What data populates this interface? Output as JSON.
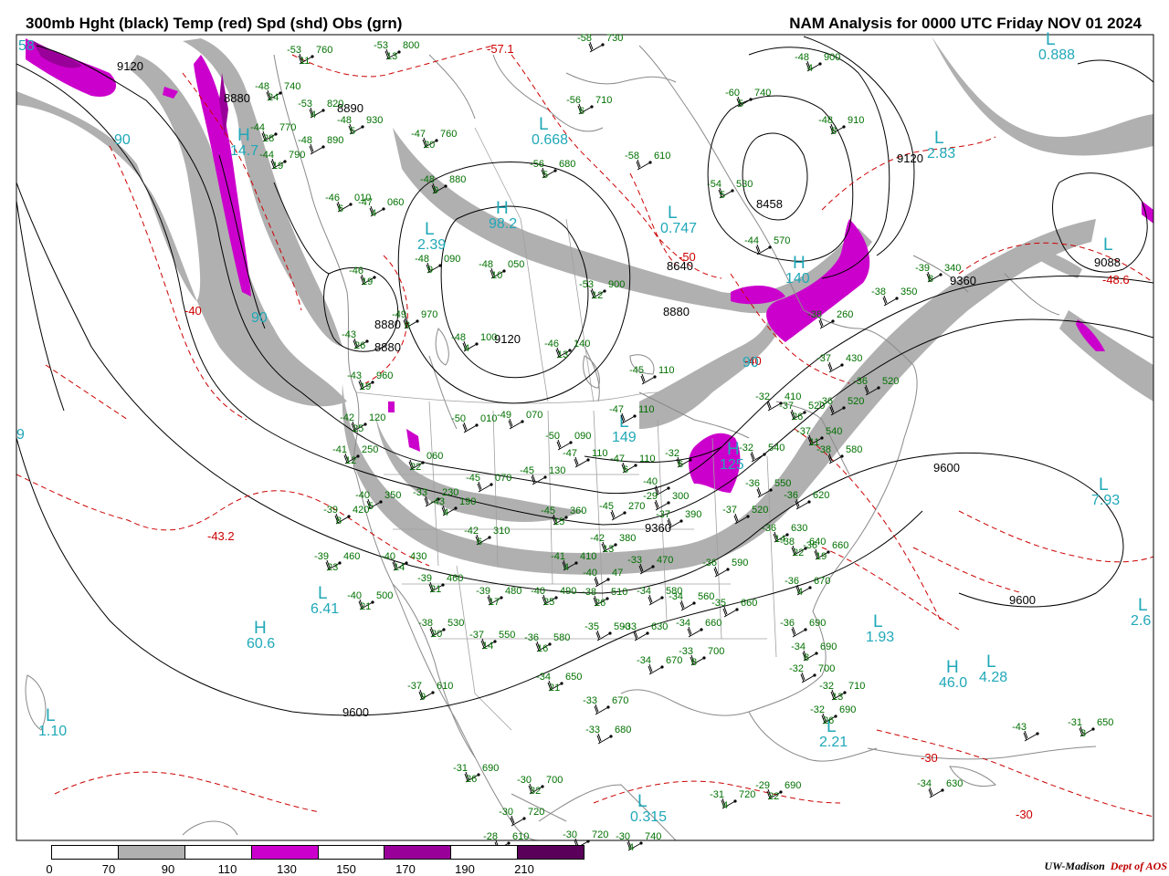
{
  "header": {
    "title_left": "300mb Hght (black) Temp (red) Spd (shd) Obs (grn)",
    "title_right": "NAM Analysis for 0000 UTC Friday  NOV 01 2024"
  },
  "colors": {
    "height_contour": "#000000",
    "temp_contour": "#cc0000",
    "obs": "#007000",
    "pressure_center": "#20a8b8",
    "coast": "#8a8a8a",
    "speed_70_90": "#b0b0b0",
    "speed_110_130": "#cc00cc",
    "speed_150_170": "#990099",
    "speed_190_210": "#5a005a"
  },
  "legend": {
    "ticks": [
      "0",
      "70",
      "90",
      "110",
      "130",
      "150",
      "170",
      "190",
      "210"
    ],
    "colors": [
      "#ffffff",
      "#b0b0b0",
      "#ffffff",
      "#cc00cc",
      "#ffffff",
      "#990099",
      "#ffffff",
      "#5a005a"
    ]
  },
  "credit": {
    "org": "UW-Madison",
    "dept": "Dept of AOS"
  },
  "height_labels": [
    "9120",
    "8880",
    "8890",
    "9120",
    "8458",
    "8640",
    "8880",
    "9360",
    "9120",
    "9088",
    "9360",
    "9600",
    "9600",
    "9600",
    "8880",
    "8880"
  ],
  "temp_labels": [
    "-57.1",
    "-50",
    "-40",
    "-40",
    "-43.2",
    "-48.6",
    "-30",
    "-30"
  ],
  "centers": [
    {
      "type": "H",
      "value": "14.7"
    },
    {
      "type": "L",
      "value": "0.668"
    },
    {
      "type": "H",
      "value": "98.2"
    },
    {
      "type": "L",
      "value": "0.747"
    },
    {
      "type": "L",
      "value": "2.39"
    },
    {
      "type": "L",
      "value": "2.83"
    },
    {
      "type": "L",
      "value": "0.888"
    },
    {
      "type": "H",
      "value": "140"
    },
    {
      "type": "L",
      "value": "149"
    },
    {
      "type": "H",
      "value": "125"
    },
    {
      "type": "L",
      "value": "7.93"
    },
    {
      "type": "H",
      "value": "60.6"
    },
    {
      "type": "L",
      "value": "6.41"
    },
    {
      "type": "L",
      "value": "1.93"
    },
    {
      "type": "H",
      "value": "46.0"
    },
    {
      "type": "L",
      "value": "4.28"
    },
    {
      "type": "L",
      "value": "2.21"
    },
    {
      "type": "L",
      "value": "1.10"
    },
    {
      "type": "L",
      "value": "0.315"
    },
    {
      "type": "L",
      "value": "2.6"
    },
    {
      "type": "L",
      "value": ""
    }
  ],
  "speed_labels": [
    "90",
    "90",
    "90",
    "58",
    "9"
  ],
  "stations": [
    {
      "temp": "-53",
      "hgt": "760",
      "sub": "11"
    },
    {
      "temp": "-53",
      "hgt": "800",
      "sub": "13"
    },
    {
      "temp": "-58",
      "hgt": "730",
      "sub": ""
    },
    {
      "temp": "-48",
      "hgt": "740",
      "sub": "24"
    },
    {
      "temp": "-53",
      "hgt": "820",
      "sub": "4"
    },
    {
      "temp": "-48",
      "hgt": "930",
      "sub": "5"
    },
    {
      "temp": "-44",
      "hgt": "770",
      "sub": "28"
    },
    {
      "temp": "-44",
      "hgt": "790",
      "sub": "19"
    },
    {
      "temp": "-48",
      "hgt": "890",
      "sub": ""
    },
    {
      "temp": "-47",
      "hgt": "760",
      "sub": "20"
    },
    {
      "temp": "-56",
      "hgt": "710",
      "sub": "6"
    },
    {
      "temp": "-56",
      "hgt": "680",
      "sub": "5"
    },
    {
      "temp": "-58",
      "hgt": "610",
      "sub": ""
    },
    {
      "temp": "-60",
      "hgt": "740",
      "sub": "5"
    },
    {
      "temp": "-48",
      "hgt": "900",
      "sub": "4"
    },
    {
      "temp": "-48",
      "hgt": "910",
      "sub": "8"
    },
    {
      "temp": "-54",
      "hgt": "530",
      "sub": "5"
    },
    {
      "temp": "-44",
      "hgt": "570",
      "sub": ""
    },
    {
      "temp": "-48",
      "hgt": "880",
      "sub": "9"
    },
    {
      "temp": "-46",
      "hgt": "010",
      "sub": "6"
    },
    {
      "temp": "-47",
      "hgt": "060",
      "sub": "4"
    },
    {
      "temp": "-48",
      "hgt": "090",
      "sub": "9"
    },
    {
      "temp": "-48",
      "hgt": "050",
      "sub": "10"
    },
    {
      "temp": "-53",
      "hgt": "900",
      "sub": "12"
    },
    {
      "temp": "-46",
      "hgt": "",
      "sub": "19"
    },
    {
      "temp": "-49",
      "hgt": "970",
      "sub": "8"
    },
    {
      "temp": "-48",
      "hgt": "100",
      "sub": "4"
    },
    {
      "temp": "-46",
      "hgt": "140",
      "sub": "13"
    },
    {
      "temp": "-45",
      "hgt": "110",
      "sub": ""
    },
    {
      "temp": "-43",
      "hgt": "",
      "sub": "26"
    },
    {
      "temp": "-43",
      "hgt": "960",
      "sub": "19"
    },
    {
      "temp": "-42",
      "hgt": "120",
      "sub": "25"
    },
    {
      "temp": "-41",
      "hgt": "250",
      "sub": "12"
    },
    {
      "temp": "",
      "hgt": "060",
      "sub": "22"
    },
    {
      "temp": "-50",
      "hgt": "010",
      "sub": ""
    },
    {
      "temp": "-49",
      "hgt": "070",
      "sub": ""
    },
    {
      "temp": "-50",
      "hgt": "090",
      "sub": ""
    },
    {
      "temp": "-47",
      "hgt": "110",
      "sub": ""
    },
    {
      "temp": "-47",
      "hgt": "110",
      "sub": ""
    },
    {
      "temp": "-47",
      "hgt": "110",
      "sub": "6"
    },
    {
      "temp": "-40",
      "hgt": "",
      "sub": ""
    },
    {
      "temp": "-32",
      "hgt": "",
      "sub": "6"
    },
    {
      "temp": "-39",
      "hgt": "340",
      "sub": "8"
    },
    {
      "temp": "-38",
      "hgt": "350",
      "sub": ""
    },
    {
      "temp": "-38",
      "hgt": "260",
      "sub": ""
    },
    {
      "temp": "-37",
      "hgt": "430",
      "sub": ""
    },
    {
      "temp": "-36",
      "hgt": "520",
      "sub": ""
    },
    {
      "temp": "-37",
      "hgt": "520",
      "sub": "26"
    },
    {
      "temp": "-32",
      "hgt": "410",
      "sub": ""
    },
    {
      "temp": "-36",
      "hgt": "520",
      "sub": ""
    },
    {
      "temp": "-37",
      "hgt": "540",
      "sub": "11"
    },
    {
      "temp": "-32",
      "hgt": "540",
      "sub": ""
    },
    {
      "temp": "-38",
      "hgt": "580",
      "sub": ""
    },
    {
      "temp": "-45",
      "hgt": "070",
      "sub": ""
    },
    {
      "temp": "-45",
      "hgt": "130",
      "sub": ""
    },
    {
      "temp": "-40",
      "hgt": "350",
      "sub": "5"
    },
    {
      "temp": "-33",
      "hgt": "230",
      "sub": ""
    },
    {
      "temp": "-39",
      "hgt": "420",
      "sub": "8"
    },
    {
      "temp": "-43",
      "hgt": "190",
      "sub": "4"
    },
    {
      "temp": "-42",
      "hgt": "310",
      "sub": "6"
    },
    {
      "temp": "-45",
      "hgt": "360",
      "sub": "15"
    },
    {
      "temp": "-45",
      "hgt": "270",
      "sub": ""
    },
    {
      "temp": "-29",
      "hgt": "300",
      "sub": ""
    },
    {
      "temp": "-37",
      "hgt": "390",
      "sub": ""
    },
    {
      "temp": "-42",
      "hgt": "380",
      "sub": "13"
    },
    {
      "temp": "-41",
      "hgt": "410",
      "sub": "4"
    },
    {
      "temp": "-39",
      "hgt": "460",
      "sub": "23"
    },
    {
      "temp": "-40",
      "hgt": "430",
      "sub": "14"
    },
    {
      "temp": "-33",
      "hgt": "470",
      "sub": ""
    },
    {
      "temp": "-40",
      "hgt": "47",
      "sub": ""
    },
    {
      "temp": "-36",
      "hgt": "590",
      "sub": ""
    },
    {
      "temp": "-36",
      "hgt": "550",
      "sub": ""
    },
    {
      "temp": "-36",
      "hgt": "620",
      "sub": ""
    },
    {
      "temp": "-37",
      "hgt": "520",
      "sub": ""
    },
    {
      "temp": "-36",
      "hgt": "630",
      "sub": "14"
    },
    {
      "temp": "-38",
      "hgt": "640",
      "sub": "22"
    },
    {
      "temp": "-36",
      "hgt": "660",
      "sub": "19"
    },
    {
      "temp": "-39",
      "hgt": "460",
      "sub": "21"
    },
    {
      "temp": "-40",
      "hgt": "500",
      "sub": "21"
    },
    {
      "temp": "-39",
      "hgt": "480",
      "sub": "17"
    },
    {
      "temp": "-40",
      "hgt": "490",
      "sub": "25"
    },
    {
      "temp": "-38",
      "hgt": "510",
      "sub": "26"
    },
    {
      "temp": "-34",
      "hgt": "580",
      "sub": ""
    },
    {
      "temp": "-34",
      "hgt": "560",
      "sub": ""
    },
    {
      "temp": "-35",
      "hgt": "660",
      "sub": ""
    },
    {
      "temp": "-36",
      "hgt": "670",
      "sub": "4"
    },
    {
      "temp": "-38",
      "hgt": "530",
      "sub": "20"
    },
    {
      "temp": "-37",
      "hgt": "550",
      "sub": "14"
    },
    {
      "temp": "-36",
      "hgt": "580",
      "sub": "16"
    },
    {
      "temp": "-35",
      "hgt": "590",
      "sub": ""
    },
    {
      "temp": "-33",
      "hgt": "630",
      "sub": ""
    },
    {
      "temp": "-34",
      "hgt": "660",
      "sub": ""
    },
    {
      "temp": "-36",
      "hgt": "690",
      "sub": ""
    },
    {
      "temp": "-34",
      "hgt": "690",
      "sub": "8"
    },
    {
      "temp": "-37",
      "hgt": "610",
      "sub": "9"
    },
    {
      "temp": "-34",
      "hgt": "650",
      "sub": "21"
    },
    {
      "temp": "-33",
      "hgt": "670",
      "sub": ""
    },
    {
      "temp": "-34",
      "hgt": "670",
      "sub": ""
    },
    {
      "temp": "-33",
      "hgt": "700",
      "sub": "8"
    },
    {
      "temp": "-32",
      "hgt": "700",
      "sub": ""
    },
    {
      "temp": "-32",
      "hgt": "710",
      "sub": "13"
    },
    {
      "temp": "-32",
      "hgt": "690",
      "sub": "26"
    },
    {
      "temp": "-33",
      "hgt": "680",
      "sub": ""
    },
    {
      "temp": "-31",
      "hgt": "690",
      "sub": "26"
    },
    {
      "temp": "-30",
      "hgt": "700",
      "sub": "32"
    },
    {
      "temp": "-30",
      "hgt": "720",
      "sub": ""
    },
    {
      "temp": "-28",
      "hgt": "610",
      "sub": ""
    },
    {
      "temp": "-30",
      "hgt": "720",
      "sub": ""
    },
    {
      "temp": "-30",
      "hgt": "740",
      "sub": "4"
    },
    {
      "temp": "-31",
      "hgt": "720",
      "sub": "4"
    },
    {
      "temp": "-29",
      "hgt": "690",
      "sub": "22"
    },
    {
      "temp": "-34",
      "hgt": "630",
      "sub": ""
    },
    {
      "temp": "-31",
      "hgt": "650",
      "sub": "3"
    },
    {
      "temp": "-43",
      "hgt": "",
      "sub": ""
    }
  ]
}
